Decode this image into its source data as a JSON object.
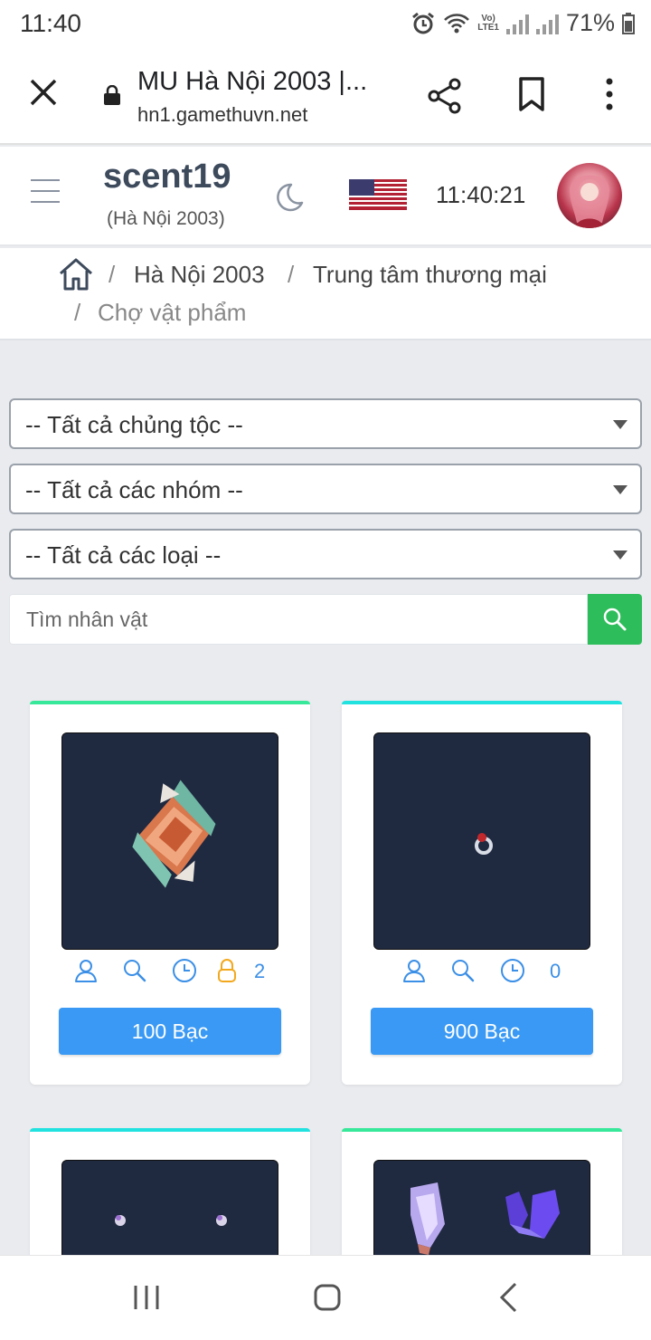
{
  "status_bar": {
    "time": "11:40",
    "battery": "71%",
    "network": "LTE1"
  },
  "browser": {
    "title": "MU Hà Nội 2003 |...",
    "url": "hn1.gamethuvn.net"
  },
  "header": {
    "username": "scent19",
    "server": "(Hà Nội 2003)",
    "clock": "11:40:21",
    "avatar_color": "#b8344b"
  },
  "breadcrumb": {
    "items": [
      "Hà Nội 2003",
      "Trung tâm thương mại"
    ],
    "current": "Chợ vật phẩm",
    "separator": "/"
  },
  "filters": {
    "race": "-- Tất cả chủng tộc --",
    "group": "-- Tất cả các nhóm --",
    "type": "-- Tất cả các loại --",
    "search_placeholder": "Tìm nhân vật"
  },
  "colors": {
    "search_button": "#2ebd5b",
    "price_button": "#3999f4",
    "icon_blue": "#3b8fe6",
    "lock_orange": "#f2a81d",
    "thumb_bg": "#1f2940"
  },
  "cards": [
    {
      "lock_count": "2",
      "price": "100 Bạc",
      "accent": "#38e89a",
      "icon": "armor-item-image"
    },
    {
      "lock_count": "0",
      "price": "900 Bạc",
      "accent": "#22e2e0",
      "icon": "ring-item-image"
    },
    {
      "accent": "#22e2e0",
      "icon": "earrings-item-image"
    },
    {
      "accent": "#38e89a",
      "icon": "gloves-item-image"
    }
  ]
}
